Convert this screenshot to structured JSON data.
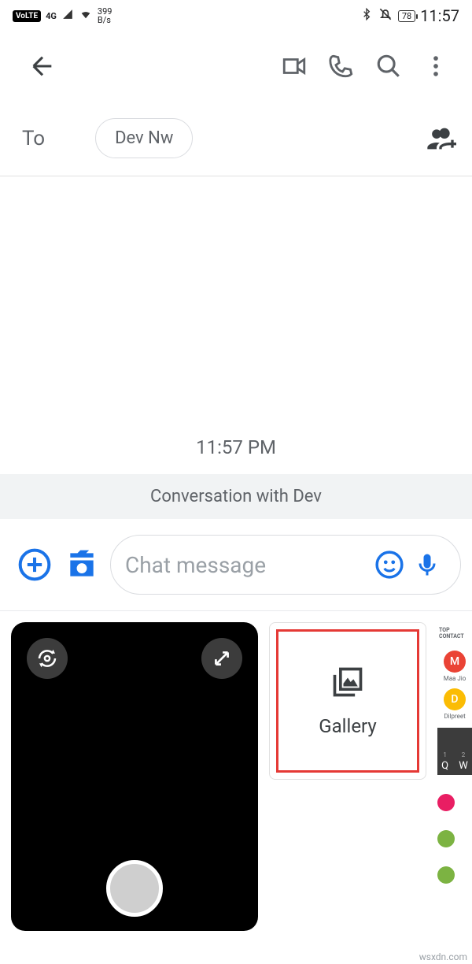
{
  "status": {
    "volte": "VoLTE",
    "net": "4G",
    "bps_top": "399",
    "bps_bot": "B/s",
    "battery": "78",
    "time": "11:57"
  },
  "to": {
    "label": "To",
    "chip": "Dev Nw"
  },
  "conversation": {
    "timestamp": "11:57 PM",
    "banner": "Conversation with Dev"
  },
  "compose": {
    "placeholder": "Chat message"
  },
  "attachments": {
    "gallery_label": "Gallery"
  },
  "peek": {
    "header": "TOP CONTACT",
    "contacts": [
      {
        "initial": "M",
        "color": "#ea4335",
        "name": "Maa Jio"
      },
      {
        "initial": "D",
        "color": "#fbbc04",
        "name": "Dilpreet"
      }
    ],
    "keys": [
      {
        "num": "1",
        "letter": "Q"
      },
      {
        "num": "2",
        "letter": "W"
      }
    ]
  },
  "watermark": "wsxdn.com"
}
